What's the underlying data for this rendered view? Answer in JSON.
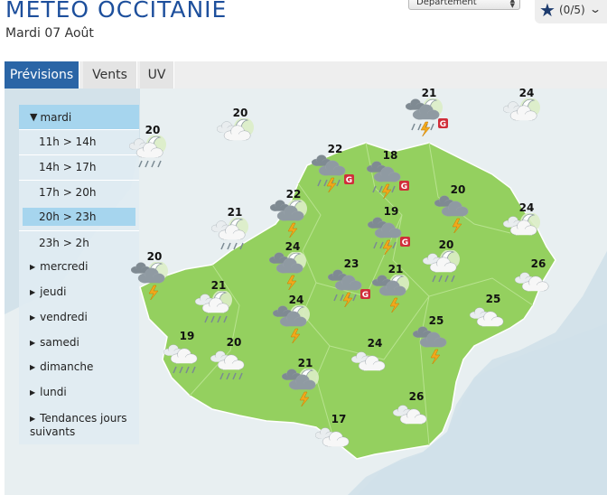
{
  "header": {
    "title": "METEO OCCITANIE",
    "date": "Mardi 07 Août",
    "department_select": "Département",
    "favorites": {
      "count": "(0/5)",
      "icon": "star-icon",
      "chevron": "chevron-down-icon"
    }
  },
  "tabs": [
    {
      "label": "Prévisions",
      "active": true
    },
    {
      "label": "Vents",
      "active": false
    },
    {
      "label": "UV",
      "active": false
    }
  ],
  "panel": {
    "days": [
      {
        "label": "mardi",
        "expanded": true
      },
      {
        "label": "mercredi"
      },
      {
        "label": "jeudi"
      },
      {
        "label": "vendredi"
      },
      {
        "label": "samedi"
      },
      {
        "label": "dimanche"
      },
      {
        "label": "lundi"
      },
      {
        "label": "Tendances jours suivants"
      }
    ],
    "slots": [
      {
        "label": "11h > 14h",
        "active": false
      },
      {
        "label": "14h > 17h",
        "active": false
      },
      {
        "label": "17h > 20h",
        "active": false
      },
      {
        "label": "20h > 23h",
        "active": true
      },
      {
        "label": "23h > 2h",
        "active": false
      }
    ]
  },
  "colors": {
    "title": "#1d4f9c",
    "tab_active": "#2a65a6",
    "region": "#94d05f",
    "sea": "#d3e2ea",
    "selected_slot": "#a6d5ee",
    "storm_badge": "#d02e3a"
  },
  "forecasts": [
    {
      "temp": "21",
      "icon": "moon-thunderstorm-hail-icon"
    },
    {
      "temp": "24",
      "icon": "moon-cloud-icon"
    },
    {
      "temp": "20",
      "icon": "moon-cloud-rain-icon"
    },
    {
      "temp": "20",
      "icon": "moon-cloud-icon"
    },
    {
      "temp": "22",
      "icon": "thunderstorm-hail-icon"
    },
    {
      "temp": "18",
      "icon": "thunderstorm-hail-icon"
    },
    {
      "temp": "20",
      "icon": "thunderstorm-icon"
    },
    {
      "temp": "22",
      "icon": "moon-thunderstorm-icon"
    },
    {
      "temp": "19",
      "icon": "thunderstorm-hail-icon"
    },
    {
      "temp": "24",
      "icon": "moon-cloud-icon"
    },
    {
      "temp": "21",
      "icon": "moon-cloud-rain-icon"
    },
    {
      "temp": "24",
      "icon": "moon-thunderstorm-icon"
    },
    {
      "temp": "20",
      "icon": "moon-thunderstorm-icon"
    },
    {
      "temp": "20",
      "icon": "moon-cloud-rain-icon"
    },
    {
      "temp": "26",
      "icon": "cloud-icon"
    },
    {
      "temp": "23",
      "icon": "thunderstorm-hail-icon"
    },
    {
      "temp": "21",
      "icon": "moon-thunderstorm-icon"
    },
    {
      "temp": "21",
      "icon": "moon-cloud-rain-icon"
    },
    {
      "temp": "25",
      "icon": "cloud-icon"
    },
    {
      "temp": "24",
      "icon": "moon-thunderstorm-icon"
    },
    {
      "temp": "25",
      "icon": "thunderstorm-icon"
    },
    {
      "temp": "19",
      "icon": "cloud-rain-icon"
    },
    {
      "temp": "20",
      "icon": "cloud-rain-icon"
    },
    {
      "temp": "24",
      "icon": "cloud-icon"
    },
    {
      "temp": "21",
      "icon": "moon-thunderstorm-icon"
    },
    {
      "temp": "26",
      "icon": "cloud-icon"
    },
    {
      "temp": "17",
      "icon": "cloud-icon"
    }
  ]
}
